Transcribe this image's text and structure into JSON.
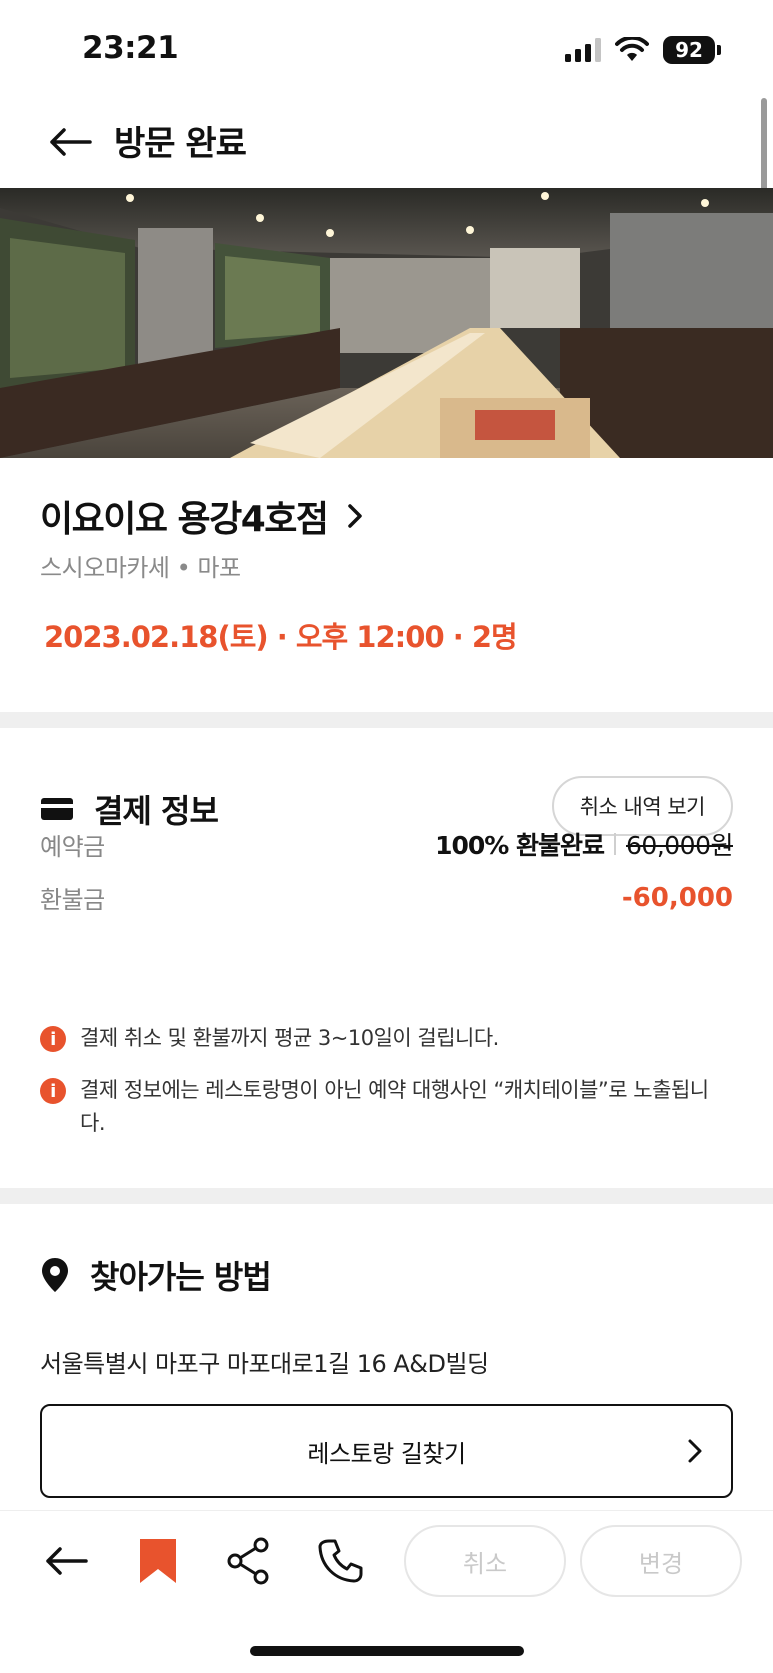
{
  "status_bar": {
    "time": "23:21",
    "battery": "92"
  },
  "header": {
    "title": "방문 완료",
    "back_icon": "arrow-left-icon"
  },
  "hero": {
    "icon": "restaurant-photo"
  },
  "restaurant": {
    "name": "이요이요 용강4호점",
    "meta": "스시오마카세 • 마포",
    "reservation": "2023.02.18(토) · 오후 12:00 · 2명"
  },
  "payment": {
    "title": "결제 정보",
    "history_button": "취소 내역 보기",
    "deposit_label": "예약금",
    "refund_status": "100% 환불완료",
    "original_amount": "60,000원",
    "refund_label": "환불금",
    "refund_amount": "-60,000",
    "notices": [
      "결제 취소 및 환불까지 평균 3~10일이 걸립니다.",
      "결제 정보에는 레스토랑명이 아닌 예약 대행사인 “캐치테이블”로 노출됩니다."
    ]
  },
  "directions": {
    "title": "찾아가는 방법",
    "address": "서울특별시 마포구 마포대로1길 16 A&D빌딩",
    "button": "레스토랑 길찾기"
  },
  "bottom_bar": {
    "cancel": "취소",
    "change": "변경",
    "icons": [
      "arrow-left-icon",
      "bookmark-icon",
      "share-icon",
      "phone-icon"
    ]
  },
  "colors": {
    "accent": "#e8532d",
    "divider": "#efefef"
  }
}
